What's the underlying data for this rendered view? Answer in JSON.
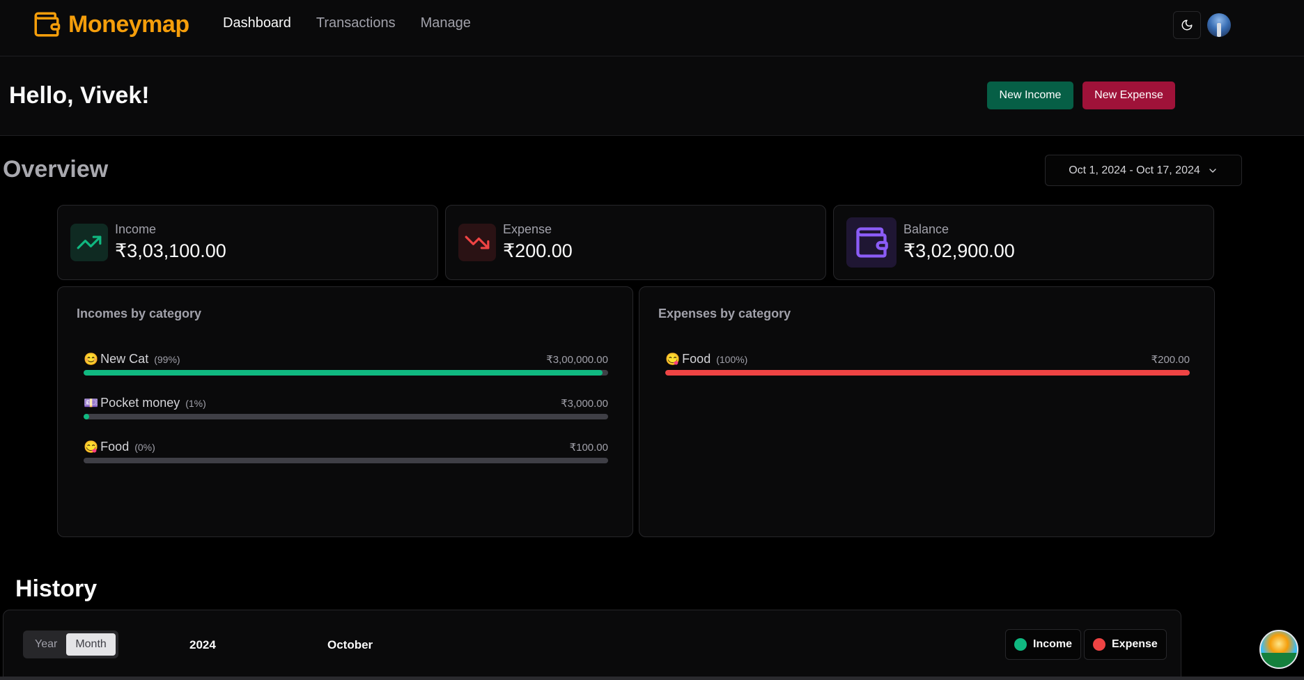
{
  "brand": {
    "name": "Moneymap",
    "accent": "#f59e0b"
  },
  "nav": {
    "items": [
      "Dashboard",
      "Transactions",
      "Manage"
    ],
    "active": "Dashboard"
  },
  "greeting": "Hello, Vivek!",
  "actions": {
    "new_income": "New Income",
    "new_expense": "New Expense"
  },
  "overview": {
    "title": "Overview",
    "date_range": "Oct 1, 2024 - Oct 17, 2024",
    "stats": [
      {
        "label": "Income",
        "value": "₹3,03,100.00",
        "icon": "trending-up-icon",
        "color": "#10b981"
      },
      {
        "label": "Expense",
        "value": "₹200.00",
        "icon": "trending-down-icon",
        "color": "#ef4444"
      },
      {
        "label": "Balance",
        "value": "₹3,02,900.00",
        "icon": "wallet-icon",
        "color": "#8b5cf6"
      }
    ]
  },
  "incomes_by_category": {
    "title": "Incomes by category",
    "items": [
      {
        "emoji": "😊",
        "name": "New Cat",
        "percent": "(99%)",
        "amount": "₹3,00,000.00",
        "fill": 0.99
      },
      {
        "emoji": "💷",
        "name": "Pocket money",
        "percent": "(1%)",
        "amount": "₹3,000.00",
        "fill": 0.01
      },
      {
        "emoji": "😋",
        "name": "Food",
        "percent": "(0%)",
        "amount": "₹100.00",
        "fill": 0.0
      }
    ]
  },
  "expenses_by_category": {
    "title": "Expenses by category",
    "items": [
      {
        "emoji": "😋",
        "name": "Food",
        "percent": "(100%)",
        "amount": "₹200.00",
        "fill": 1.0
      }
    ]
  },
  "history": {
    "title": "History",
    "periods": [
      "Year",
      "Month"
    ],
    "active_period": "Month",
    "year": "2024",
    "month": "October",
    "legend": [
      {
        "label": "Income",
        "color": "#10b981"
      },
      {
        "label": "Expense",
        "color": "#ef4444"
      }
    ]
  }
}
